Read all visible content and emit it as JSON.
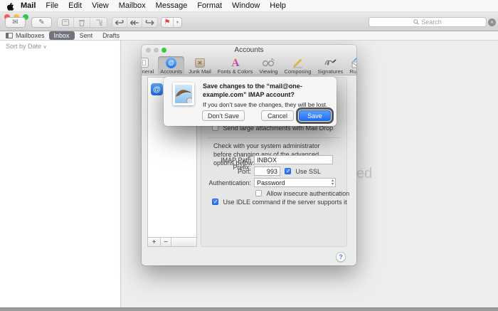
{
  "menubar": {
    "items": [
      "Mail",
      "File",
      "Edit",
      "View",
      "Mailbox",
      "Message",
      "Format",
      "Window",
      "Help"
    ]
  },
  "toolbar": {
    "search_placeholder": "Search"
  },
  "icons": {
    "checkmark": "✓",
    "sort_chevron": "∨",
    "flag": "⚑",
    "flag_chevron": "▾",
    "reply": "↩",
    "reply_all": "↞",
    "forward": "↪",
    "envelope": "✉",
    "compose": "✎",
    "clear_x": "✕",
    "junk_x": "✕",
    "stepper": "▴▾"
  },
  "favorites": {
    "mailboxes_label": "Mailboxes",
    "tabs": [
      "Inbox",
      "Sent",
      "Drafts"
    ],
    "selected_tab": "Inbox"
  },
  "message_list": {
    "sort_label": "Sort by Date"
  },
  "viewer": {
    "partial_text": "ed"
  },
  "prefs": {
    "title": "Accounts",
    "toolbar": [
      {
        "label": "General"
      },
      {
        "label": "Accounts",
        "selected": true
      },
      {
        "label": "Junk Mail"
      },
      {
        "label": "Fonts & Colors"
      },
      {
        "label": "Viewing"
      },
      {
        "label": "Composing"
      },
      {
        "label": "Signatures"
      },
      {
        "label": "Rules"
      }
    ],
    "fonts_icon_letter": "A",
    "account_icon": "@",
    "account_list": {
      "add_label": "+",
      "remove_label": "−"
    },
    "form": {
      "mail_drop_label": "Send large attachments with Mail Drop",
      "mail_drop_checked": false,
      "admin_note": "Check with your system administrator before changing any of the advanced options below:",
      "imap_path_label": "IMAP Path Prefix:",
      "imap_path_value": "INBOX",
      "port_label": "Port:",
      "port_value": "993",
      "use_ssl_label": "Use SSL",
      "use_ssl_checked": true,
      "auth_label": "Authentication:",
      "auth_value": "Password",
      "insecure_label": "Allow insecure authentication",
      "insecure_checked": false,
      "idle_label": "Use IDLE command if the server supports it",
      "idle_checked": true
    },
    "help_label": "?"
  },
  "dialog": {
    "title": "Save changes to the “mail@one-example.com” IMAP account?",
    "body": "If you don’t save the changes, they will be lost.",
    "buttons": {
      "dont_save": "Don’t Save",
      "cancel": "Cancel",
      "save": "Save"
    },
    "accent_color": "#2e7bf6"
  }
}
